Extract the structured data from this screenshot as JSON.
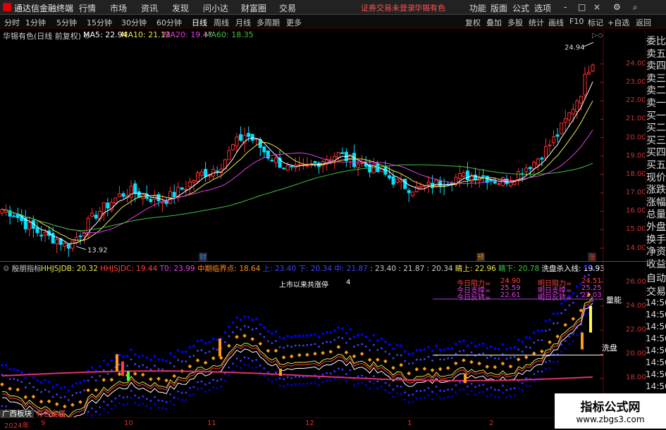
{
  "menu": {
    "app_title": "通达信金融终端",
    "items": [
      "行情",
      "市场",
      "资讯",
      "发现",
      "问小达",
      "财富圈",
      "交易"
    ],
    "account_notice": "证券交易未登录",
    "stock_name": "华锡有色",
    "right_items": [
      "功能",
      "版面",
      "公式",
      "选项"
    ],
    "window_buttons": [
      "-",
      "□",
      "×"
    ]
  },
  "toolbar": {
    "timeframes": [
      "分时",
      "1分钟",
      "5分钟",
      "15分钟",
      "30分钟",
      "60分钟",
      "日线",
      "周线",
      "月线",
      "多周期",
      "更多"
    ],
    "active": "日线",
    "right_buttons": [
      "复权",
      "叠加",
      "多股",
      "统计",
      "画线",
      "F10",
      "标记",
      "+自选",
      "返回"
    ]
  },
  "main_chart": {
    "title": "华锡有色(日线 前复权)",
    "ma": [
      {
        "label": "MA5: 22.94",
        "color": "#ffffff"
      },
      {
        "label": "MA10: 21.13",
        "color": "#e8e84a"
      },
      {
        "label": "MA20: 19.47",
        "color": "#e040e0"
      },
      {
        "label": "MA60: 18.35",
        "color": "#40c040"
      }
    ],
    "y_ticks": [
      "24.00",
      "23.00",
      "22.00",
      "21.00",
      "20.00",
      "19.00",
      "18.00",
      "17.00",
      "16.00",
      "15.00",
      "14.00"
    ],
    "high_label": "24.94",
    "low_label": "13.92",
    "markers": [
      "财",
      "预",
      "涨"
    ]
  },
  "right_panel": {
    "labels": [
      "委比",
      "卖五",
      "卖四",
      "卖三",
      "卖二",
      "卖一",
      "买一",
      "买二",
      "买三",
      "买四",
      "买五",
      "现价",
      "涨跌",
      "涨幅",
      "总量",
      "外盘",
      "换手",
      "净资",
      "收益"
    ],
    "lower_labels": [
      "自动",
      "交易"
    ],
    "times": [
      "14:56",
      "14:56",
      "14:56",
      "14:56",
      "14:56",
      "14:56",
      "14:56",
      "14:56",
      "14:56"
    ]
  },
  "indicator": {
    "name": "殷朋指标",
    "values": [
      {
        "text": "HHJSJDB: 20.32",
        "color": "#e8e84a"
      },
      {
        "text": "HHJSJDC: 19.44",
        "color": "#ff4040"
      },
      {
        "text": "T0: 23.99",
        "color": "#e040e0"
      },
      {
        "text": "中期临界点: 18.64",
        "color": "#ff8c1a"
      },
      {
        "text": "上: 23.40",
        "color": "#4040ff"
      },
      {
        "text": "下: 20.34",
        "color": "#4040ff"
      },
      {
        "text": "中: 21.87",
        "color": "#4040ff"
      },
      {
        "text": ": 23.40",
        "color": "#cccccc"
      },
      {
        "text": ": 21.87",
        "color": "#cccccc"
      },
      {
        "text": ": 20.34",
        "color": "#cccccc"
      },
      {
        "text": "睛上: 22.96",
        "color": "#e8e84a"
      },
      {
        "text": "睛下: 20.78",
        "color": "#40c040"
      },
      {
        "text": "洗盘杀入线: 19.93",
        "color": "#ffffff"
      }
    ],
    "y_ticks": [
      "26.00",
      "24.00",
      "22.00",
      "20.00",
      "18.00",
      "16.00"
    ],
    "limit_text": "上市以来共涨停",
    "limit_count": "4",
    "today_labels": [
      "今日阻力=",
      "今日支撑=",
      "今日反转="
    ],
    "today_values": [
      "24.90",
      "25.59",
      "22.61"
    ],
    "tomorrow_labels": [
      "明日阻力=",
      "明日支撑=",
      "明日反转="
    ],
    "tomorrow_values": [
      "24.51",
      "25.25",
      "22.03"
    ],
    "line_labels": [
      "量能",
      "洗盘"
    ]
  },
  "bottom": {
    "year": "2024年",
    "months": [
      "9",
      "10",
      "11",
      "12",
      "1",
      "2"
    ],
    "sectors": [
      "广西板块",
      "有色金属"
    ]
  },
  "watermark": {
    "text": "指标公式网",
    "url": "www.zbgs3.com"
  },
  "chart_data": {
    "type": "candlestick",
    "title": "华锡有色(日线 前复权)",
    "ylim": [
      13.6,
      25.6
    ],
    "ma": {
      "MA5": 22.94,
      "MA10": 21.13,
      "MA20": 19.47,
      "MA60": 18.35
    },
    "high": 24.94,
    "low": 13.92,
    "close_points": [
      [
        0,
        16.1
      ],
      [
        10,
        15.9
      ],
      [
        20,
        15.3
      ],
      [
        30,
        14.9
      ],
      [
        40,
        14.6
      ],
      [
        50,
        14.4
      ],
      [
        55,
        14.1
      ],
      [
        60,
        14.3
      ],
      [
        70,
        15.0
      ],
      [
        80,
        15.8
      ],
      [
        90,
        16.3
      ],
      [
        100,
        16.8
      ],
      [
        110,
        17.1
      ],
      [
        120,
        16.9
      ],
      [
        130,
        16.7
      ],
      [
        140,
        16.6
      ],
      [
        150,
        17.0
      ],
      [
        160,
        17.4
      ],
      [
        170,
        18.0
      ],
      [
        180,
        18.2
      ],
      [
        190,
        18.6
      ],
      [
        200,
        19.6
      ],
      [
        210,
        20.2
      ],
      [
        220,
        19.7
      ],
      [
        230,
        19.0
      ],
      [
        240,
        18.6
      ],
      [
        250,
        18.2
      ],
      [
        260,
        18.3
      ],
      [
        270,
        18.6
      ],
      [
        280,
        18.9
      ],
      [
        290,
        19.1
      ],
      [
        300,
        18.8
      ],
      [
        310,
        18.6
      ],
      [
        320,
        18.3
      ],
      [
        330,
        18.0
      ],
      [
        340,
        17.6
      ],
      [
        350,
        17.3
      ],
      [
        360,
        17.2
      ],
      [
        370,
        17.4
      ],
      [
        380,
        17.6
      ],
      [
        390,
        17.8
      ],
      [
        400,
        17.9
      ],
      [
        410,
        18.0
      ],
      [
        420,
        17.8
      ],
      [
        430,
        17.6
      ],
      [
        440,
        17.8
      ],
      [
        450,
        18.3
      ],
      [
        460,
        18.7
      ],
      [
        470,
        19.4
      ],
      [
        480,
        20.2
      ],
      [
        490,
        21.3
      ],
      [
        500,
        22.5
      ],
      [
        505,
        23.6
      ],
      [
        510,
        24.2
      ]
    ]
  }
}
